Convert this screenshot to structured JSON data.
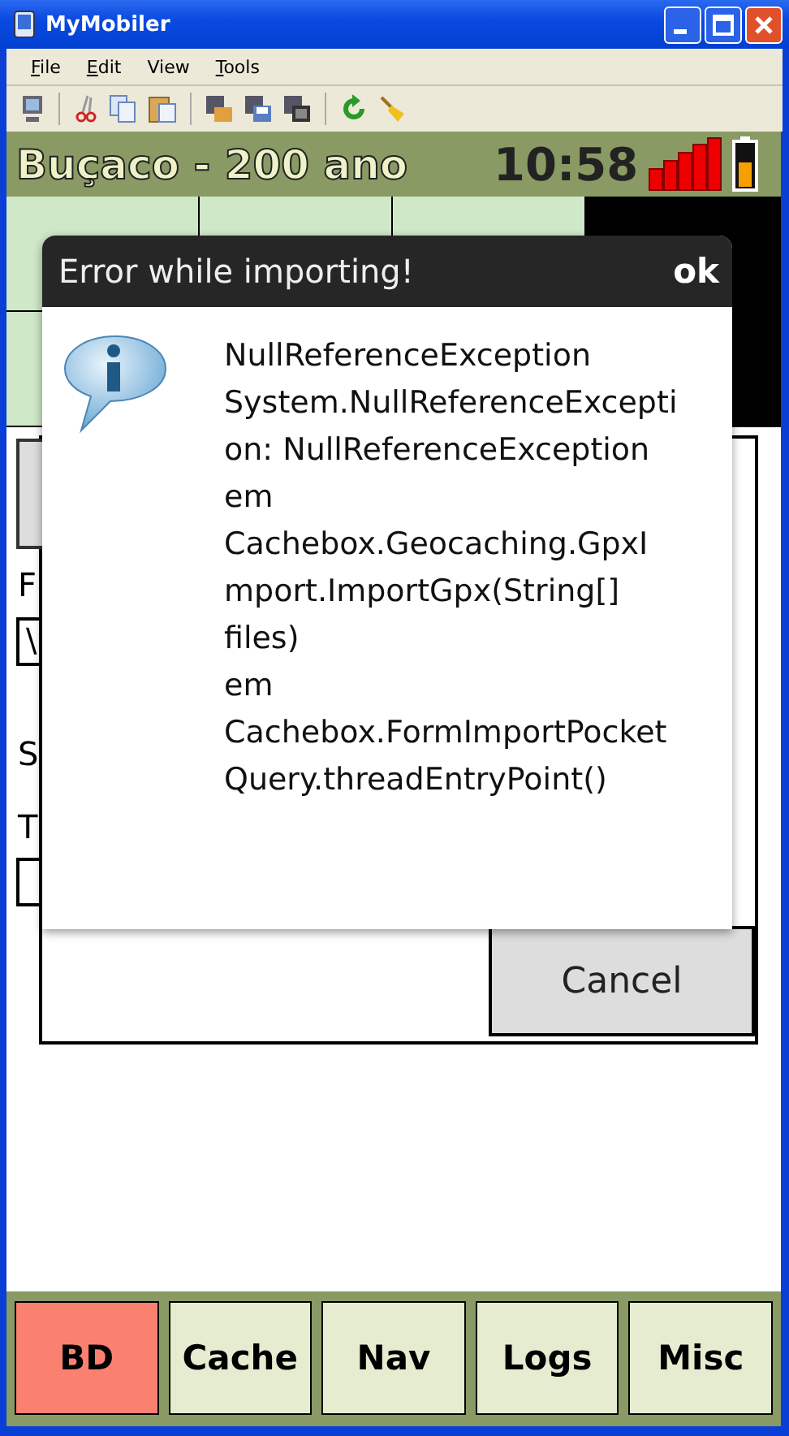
{
  "window": {
    "title": "MyMobiler"
  },
  "menu": [
    {
      "label": "File",
      "mnemonic": true
    },
    {
      "label": "Edit",
      "mnemonic": true
    },
    {
      "label": "View",
      "mnemonic": false
    },
    {
      "label": "Tools",
      "mnemonic": true
    }
  ],
  "header": {
    "title": "Buçaco - 200 ano",
    "time": "10:58"
  },
  "form": {
    "labels": [
      "F",
      "S",
      "T"
    ],
    "path_value": "\\",
    "cancel": "Cancel"
  },
  "dialog": {
    "title": "Error while importing!",
    "ok": "ok",
    "lines": [
      "NullReferenceException",
      "System.NullReferenceExcepti",
      "on: NullReferenceException",
      "em",
      "Cachebox.Geocaching.GpxI",
      "mport.ImportGpx(String[]",
      "files)",
      "em",
      "Cachebox.FormImportPocket",
      "Query.threadEntryPoint()"
    ]
  },
  "tabs": [
    {
      "label": "BD",
      "selected": true
    },
    {
      "label": "Cache",
      "selected": false
    },
    {
      "label": "Nav",
      "selected": false
    },
    {
      "label": "Logs",
      "selected": false
    },
    {
      "label": "Misc",
      "selected": false
    }
  ]
}
